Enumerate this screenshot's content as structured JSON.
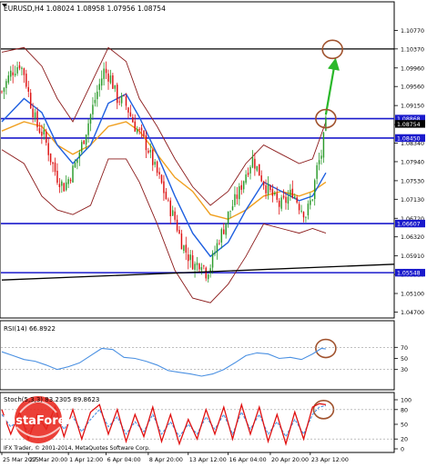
{
  "window_title": "EURUSD,H4  1.08024 1.08958 1.07956 1.08754",
  "main_chart": {
    "type": "candlestick",
    "symbol": "EURUSD",
    "timeframe": "H4",
    "quote": {
      "open": 1.08024,
      "high": 1.08958,
      "low": 1.07956,
      "close": 1.08754
    },
    "ylim": [
      1.0465,
      1.1115
    ],
    "y_ticks": [
      "1.10770",
      "1.10370",
      "1.09960",
      "1.09560",
      "1.09150",
      "1.08740",
      "1.08340",
      "1.07940",
      "1.07530",
      "1.07130",
      "1.06720",
      "1.06320",
      "1.05910",
      "1.05510",
      "1.05100",
      "1.04700"
    ],
    "price_labels": [
      {
        "label": "1.08868",
        "value": 1.08868,
        "color": "#1a1acc"
      },
      {
        "label": "1.08754",
        "value": 1.08754,
        "color": "#000000"
      },
      {
        "label": "1.08450",
        "value": 1.0845,
        "color": "#1a1acc"
      },
      {
        "label": "1.06607",
        "value": 1.06607,
        "color": "#1a1acc"
      },
      {
        "label": "1.05548",
        "value": 1.05548,
        "color": "#1a1acc"
      }
    ],
    "horizontal_levels": [
      {
        "value": 1.1037,
        "color": "#000000"
      },
      {
        "value": 1.08868,
        "color": "#1a1acc"
      },
      {
        "value": 1.0845,
        "color": "#1a1acc"
      },
      {
        "value": 1.06607,
        "color": "#1a1acc"
      },
      {
        "value": 1.05548,
        "color": "#1a1acc"
      }
    ],
    "trendline": {
      "from": [
        0,
        1.0539
      ],
      "to": [
        177,
        1.0573
      ],
      "color": "#000000"
    },
    "series_colors": {
      "bull": "#2a9a2a",
      "bear": "#dd1111",
      "ma_fast": "#1e5fe0",
      "ma_slow": "#f0a020",
      "bollinger": "#8b1a1a"
    },
    "close_path": [
      [
        0,
        1.0945
      ],
      [
        4,
        1.0985
      ],
      [
        8,
        1.1005
      ],
      [
        10,
        1.0985
      ],
      [
        13,
        1.092
      ],
      [
        16,
        1.087
      ],
      [
        19,
        1.085
      ],
      [
        22,
        1.08
      ],
      [
        25,
        1.076
      ],
      [
        28,
        1.074
      ],
      [
        31,
        1.0765
      ],
      [
        34,
        1.08
      ],
      [
        37,
        1.0845
      ],
      [
        40,
        1.0895
      ],
      [
        43,
        1.0945
      ],
      [
        46,
        1.099
      ],
      [
        49,
        1.0975
      ],
      [
        52,
        1.093
      ],
      [
        55,
        1.0925
      ],
      [
        57,
        1.0905
      ],
      [
        60,
        1.087
      ],
      [
        63,
        1.085
      ],
      [
        66,
        1.082
      ],
      [
        69,
        1.078
      ],
      [
        72,
        1.0745
      ],
      [
        75,
        1.07
      ],
      [
        78,
        1.067
      ],
      [
        81,
        1.062
      ],
      [
        84,
        1.059
      ],
      [
        87,
        1.057
      ],
      [
        90,
        1.058
      ],
      [
        92,
        1.0555
      ],
      [
        94,
        1.057
      ],
      [
        96,
        1.06
      ],
      [
        98,
        1.063
      ],
      [
        100,
        1.065
      ],
      [
        102,
        1.068
      ],
      [
        104,
        1.07
      ],
      [
        107,
        1.073
      ],
      [
        110,
        1.077
      ],
      [
        113,
        1.08
      ],
      [
        116,
        1.077
      ],
      [
        119,
        1.074
      ],
      [
        122,
        1.072
      ],
      [
        125,
        1.07
      ],
      [
        128,
        1.071
      ],
      [
        131,
        1.073
      ],
      [
        134,
        1.07
      ],
      [
        137,
        1.068
      ],
      [
        140,
        1.072
      ],
      [
        142,
        1.078
      ],
      [
        144,
        1.081
      ],
      [
        146,
        1.0875
      ]
    ],
    "bollinger_upper": [
      [
        0,
        1.103
      ],
      [
        10,
        1.104
      ],
      [
        18,
        1.1
      ],
      [
        25,
        1.093
      ],
      [
        32,
        1.088
      ],
      [
        40,
        1.096
      ],
      [
        48,
        1.104
      ],
      [
        56,
        1.101
      ],
      [
        62,
        1.093
      ],
      [
        70,
        1.087
      ],
      [
        78,
        1.08
      ],
      [
        86,
        1.074
      ],
      [
        94,
        1.07
      ],
      [
        102,
        1.073
      ],
      [
        110,
        1.079
      ],
      [
        118,
        1.083
      ],
      [
        126,
        1.081
      ],
      [
        134,
        1.079
      ],
      [
        140,
        1.08
      ],
      [
        146,
        1.088
      ]
    ],
    "bollinger_lower": [
      [
        0,
        1.082
      ],
      [
        10,
        1.079
      ],
      [
        18,
        1.072
      ],
      [
        25,
        1.069
      ],
      [
        32,
        1.068
      ],
      [
        40,
        1.07
      ],
      [
        48,
        1.08
      ],
      [
        56,
        1.08
      ],
      [
        62,
        1.075
      ],
      [
        70,
        1.066
      ],
      [
        78,
        1.056
      ],
      [
        86,
        1.05
      ],
      [
        94,
        1.049
      ],
      [
        102,
        1.053
      ],
      [
        110,
        1.059
      ],
      [
        118,
        1.066
      ],
      [
        126,
        1.065
      ],
      [
        134,
        1.064
      ],
      [
        140,
        1.065
      ],
      [
        146,
        1.064
      ]
    ],
    "ma_fast": [
      [
        0,
        1.088
      ],
      [
        10,
        1.093
      ],
      [
        18,
        1.09
      ],
      [
        25,
        1.083
      ],
      [
        32,
        1.079
      ],
      [
        40,
        1.083
      ],
      [
        48,
        1.092
      ],
      [
        56,
        1.094
      ],
      [
        62,
        1.089
      ],
      [
        70,
        1.081
      ],
      [
        78,
        1.072
      ],
      [
        86,
        1.064
      ],
      [
        94,
        1.059
      ],
      [
        102,
        1.062
      ],
      [
        110,
        1.069
      ],
      [
        118,
        1.075
      ],
      [
        126,
        1.073
      ],
      [
        134,
        1.071
      ],
      [
        140,
        1.072
      ],
      [
        146,
        1.077
      ]
    ],
    "ma_slow": [
      [
        0,
        1.086
      ],
      [
        10,
        1.088
      ],
      [
        18,
        1.087
      ],
      [
        25,
        1.083
      ],
      [
        32,
        1.081
      ],
      [
        40,
        1.083
      ],
      [
        48,
        1.087
      ],
      [
        56,
        1.088
      ],
      [
        62,
        1.086
      ],
      [
        70,
        1.081
      ],
      [
        78,
        1.076
      ],
      [
        86,
        1.073
      ],
      [
        94,
        1.068
      ],
      [
        102,
        1.067
      ],
      [
        110,
        1.069
      ],
      [
        118,
        1.072
      ],
      [
        126,
        1.073
      ],
      [
        134,
        1.072
      ],
      [
        140,
        1.073
      ],
      [
        146,
        1.075
      ]
    ]
  },
  "rsi": {
    "label": "RSI(14) 66.8922",
    "ylim": [
      0,
      100
    ],
    "ticks": [
      "70",
      "50",
      "30"
    ],
    "levels": [
      70,
      30
    ],
    "color": "#4a90e2",
    "values": [
      [
        0,
        62
      ],
      [
        5,
        55
      ],
      [
        10,
        48
      ],
      [
        15,
        45
      ],
      [
        20,
        38
      ],
      [
        25,
        30
      ],
      [
        30,
        35
      ],
      [
        35,
        42
      ],
      [
        40,
        55
      ],
      [
        45,
        68
      ],
      [
        50,
        66
      ],
      [
        55,
        52
      ],
      [
        60,
        50
      ],
      [
        65,
        45
      ],
      [
        70,
        38
      ],
      [
        75,
        28
      ],
      [
        80,
        25
      ],
      [
        85,
        22
      ],
      [
        90,
        18
      ],
      [
        95,
        22
      ],
      [
        100,
        30
      ],
      [
        105,
        42
      ],
      [
        110,
        55
      ],
      [
        115,
        60
      ],
      [
        120,
        58
      ],
      [
        125,
        50
      ],
      [
        130,
        52
      ],
      [
        135,
        48
      ],
      [
        140,
        58
      ],
      [
        144,
        68
      ],
      [
        146,
        67
      ]
    ]
  },
  "stochastic": {
    "label": "Stoch(5,3,3) 83.2305 89.8623",
    "ylim": [
      0,
      100
    ],
    "ticks": [
      "100",
      "80",
      "50",
      "20",
      "0"
    ],
    "levels": [
      80,
      20
    ],
    "main_color": "#e01010",
    "signal_color": "#4a90e2",
    "main": [
      [
        0,
        80
      ],
      [
        4,
        30
      ],
      [
        8,
        75
      ],
      [
        12,
        20
      ],
      [
        16,
        70
      ],
      [
        20,
        40
      ],
      [
        24,
        85
      ],
      [
        28,
        25
      ],
      [
        32,
        80
      ],
      [
        36,
        20
      ],
      [
        40,
        75
      ],
      [
        44,
        90
      ],
      [
        48,
        30
      ],
      [
        52,
        80
      ],
      [
        56,
        15
      ],
      [
        60,
        70
      ],
      [
        64,
        25
      ],
      [
        68,
        85
      ],
      [
        72,
        15
      ],
      [
        76,
        70
      ],
      [
        80,
        10
      ],
      [
        84,
        60
      ],
      [
        88,
        20
      ],
      [
        92,
        80
      ],
      [
        96,
        30
      ],
      [
        100,
        85
      ],
      [
        104,
        20
      ],
      [
        108,
        90
      ],
      [
        112,
        30
      ],
      [
        116,
        85
      ],
      [
        120,
        15
      ],
      [
        124,
        70
      ],
      [
        128,
        10
      ],
      [
        132,
        75
      ],
      [
        136,
        20
      ],
      [
        140,
        85
      ],
      [
        143,
        92
      ],
      [
        146,
        90
      ]
    ],
    "signal": [
      [
        0,
        70
      ],
      [
        4,
        45
      ],
      [
        8,
        60
      ],
      [
        12,
        35
      ],
      [
        16,
        55
      ],
      [
        20,
        45
      ],
      [
        24,
        70
      ],
      [
        28,
        40
      ],
      [
        32,
        65
      ],
      [
        36,
        35
      ],
      [
        40,
        60
      ],
      [
        44,
        80
      ],
      [
        48,
        45
      ],
      [
        52,
        65
      ],
      [
        56,
        30
      ],
      [
        60,
        55
      ],
      [
        64,
        35
      ],
      [
        68,
        70
      ],
      [
        72,
        30
      ],
      [
        76,
        55
      ],
      [
        80,
        25
      ],
      [
        84,
        50
      ],
      [
        88,
        30
      ],
      [
        92,
        65
      ],
      [
        96,
        40
      ],
      [
        100,
        70
      ],
      [
        104,
        30
      ],
      [
        108,
        75
      ],
      [
        112,
        40
      ],
      [
        116,
        70
      ],
      [
        120,
        30
      ],
      [
        124,
        55
      ],
      [
        128,
        25
      ],
      [
        132,
        60
      ],
      [
        136,
        30
      ],
      [
        140,
        70
      ],
      [
        143,
        85
      ],
      [
        146,
        88
      ]
    ]
  },
  "x_axis": {
    "bars": 177,
    "labels": [
      {
        "text": "25 Mar 2015",
        "bar": 0
      },
      {
        "text": "27 Mar 20:00",
        "bar": 12
      },
      {
        "text": "1 Apr 12:00",
        "bar": 30
      },
      {
        "text": "6 Apr 04:00",
        "bar": 47
      },
      {
        "text": "8 Apr 20:00",
        "bar": 66
      },
      {
        "text": "13 Apr 12:00",
        "bar": 84
      },
      {
        "text": "16 Apr 04:00",
        "bar": 102
      },
      {
        "text": "20 Apr 20:00",
        "bar": 121
      },
      {
        "text": "23 Apr 12:00",
        "bar": 139
      }
    ]
  },
  "annotations": {
    "arrow_color": "#2ab82a",
    "circle_color": "#a0522d",
    "arrow": {
      "from": [
        146,
        1.0895
      ],
      "to": [
        150,
        1.1005
      ]
    },
    "circles": [
      {
        "panel": "main",
        "bar": 149,
        "value": 1.1036
      },
      {
        "panel": "main",
        "bar": 146,
        "value": 1.08868
      },
      {
        "panel": "rsi",
        "bar": 146,
        "value": 68
      },
      {
        "panel": "stochastic",
        "bar": 145,
        "value": 80
      }
    ]
  },
  "watermark": "InstaForex",
  "footer": "IFX Trader, © 2001-2014, MetaQuotes Software Corp."
}
